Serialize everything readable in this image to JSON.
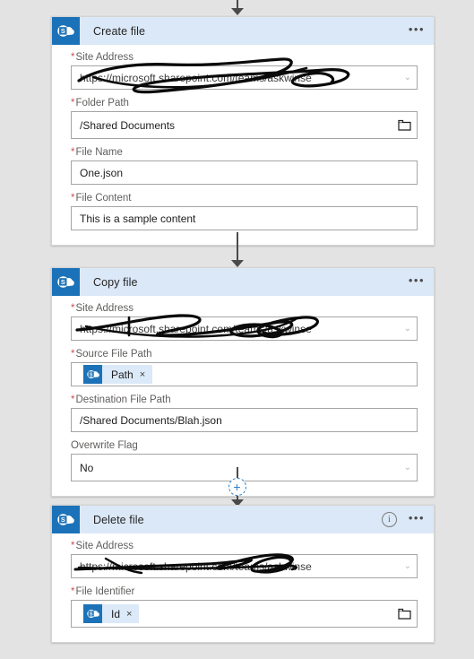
{
  "flow": {
    "background_color": "#e3e3e3",
    "accent_color": "#1b72b8",
    "header_color": "#dbe8f7",
    "required_marker": "*",
    "overflow_menu": "•••",
    "info_glyph": "i",
    "chevron_glyph": "⌄",
    "token_remove_glyph": "×",
    "add_step_label": "+",
    "icon_names": {
      "connector": "arrow-down-icon",
      "app": "sharepoint-icon",
      "dropdown": "chevron-down-icon",
      "picker": "folder-icon",
      "info": "info-icon",
      "menu": "ellipsis-icon",
      "add": "plus-icon"
    }
  },
  "cards": [
    {
      "id": "create-file",
      "title": "Create file",
      "has_info": false,
      "fields": [
        {
          "label": "Site Address",
          "required": true,
          "value": "https://microsoft.sharepoint.com/teams/askwinse",
          "control": "dropdown",
          "redacted": true
        },
        {
          "label": "Folder Path",
          "required": true,
          "value": "/Shared Documents",
          "control": "folder",
          "redacted": false
        },
        {
          "label": "File Name",
          "required": true,
          "value": "One.json",
          "control": "text",
          "redacted": false
        },
        {
          "label": "File Content",
          "required": true,
          "value": "This is a sample content",
          "control": "text",
          "redacted": false
        }
      ]
    },
    {
      "id": "copy-file",
      "title": "Copy file",
      "has_info": false,
      "fields": [
        {
          "label": "Site Address",
          "required": true,
          "value": "https://microsoft.sharepoint.com/teams/askwinse",
          "control": "dropdown",
          "redacted": true
        },
        {
          "label": "Source File Path",
          "required": true,
          "value": "",
          "control": "token",
          "token": "Path",
          "redacted": false
        },
        {
          "label": "Destination File Path",
          "required": true,
          "value": "/Shared Documents/Blah.json",
          "control": "text",
          "redacted": false
        },
        {
          "label": "Overwrite Flag",
          "required": false,
          "value": "No",
          "control": "dropdown",
          "redacted": false
        }
      ]
    },
    {
      "id": "delete-file",
      "title": "Delete file",
      "has_info": true,
      "fields": [
        {
          "label": "Site Address",
          "required": true,
          "value": "https://microsoft.sharepoint.com/teams/askwinse",
          "control": "dropdown",
          "redacted": true
        },
        {
          "label": "File Identifier",
          "required": true,
          "value": "",
          "control": "token-folder",
          "token": "Id",
          "redacted": false
        }
      ]
    }
  ]
}
